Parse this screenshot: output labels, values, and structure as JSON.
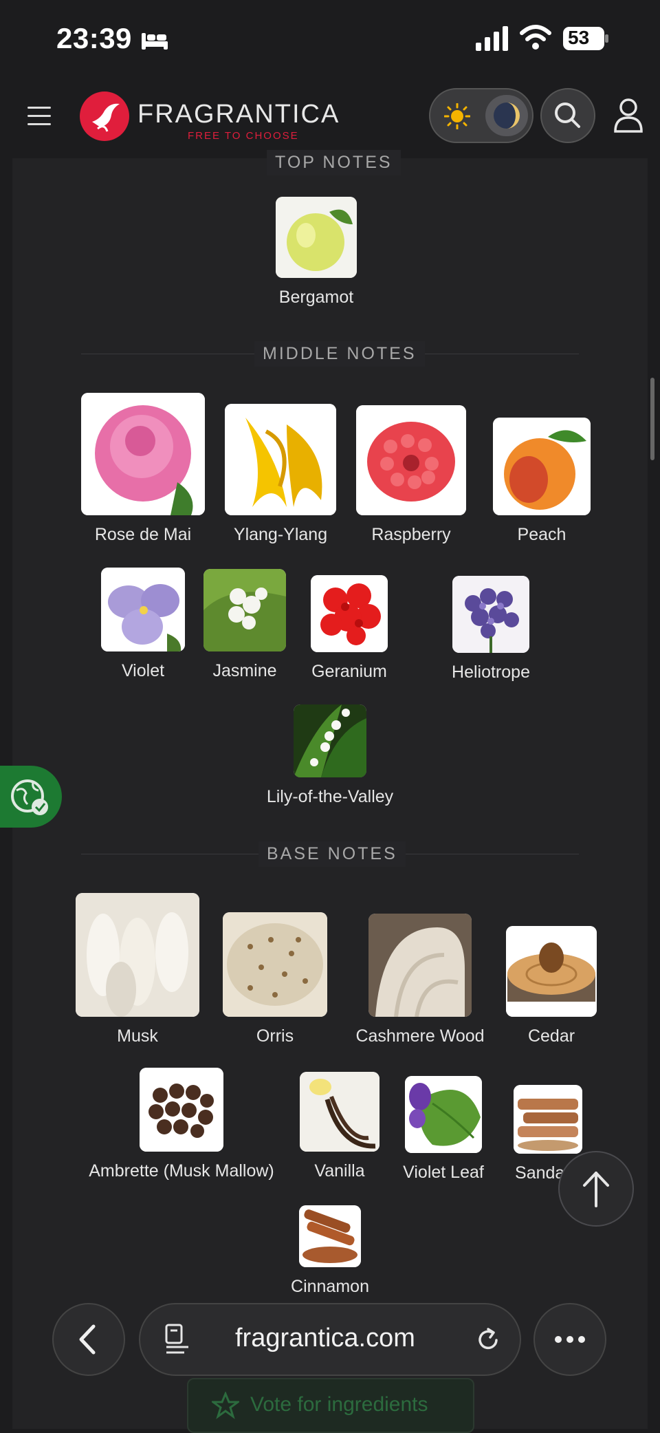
{
  "status_bar": {
    "time": "23:39",
    "battery": "53"
  },
  "header": {
    "logo_text": "FRAGRANTICA",
    "logo_tagline": "FREE TO CHOOSE"
  },
  "pyramid": {
    "top_label": "TOP NOTES",
    "top": [
      "Bergamot"
    ],
    "middle_label": "MIDDLE NOTES",
    "middle": [
      "Rose de Mai",
      "Ylang-Ylang",
      "Raspberry",
      "Peach",
      "Violet",
      "Jasmine",
      "Geranium",
      "Heliotrope",
      "Lily-of-the-Valley"
    ],
    "base_label": "BASE NOTES",
    "base": [
      "Musk",
      "Orris",
      "Cashmere Wood",
      "Cedar",
      "Ambrette (Musk Mallow)",
      "Vanilla",
      "Violet Leaf",
      "Sandalw",
      "Cinnamon"
    ]
  },
  "vote_button": "Vote for ingredients",
  "browser": {
    "url": "fragrantica.com"
  },
  "colors": {
    "brand": "#e01e3c",
    "background": "#1c1c1e",
    "panel": "#232325",
    "badge_green": "#1d7a32"
  },
  "icons": [
    "bed-icon",
    "signal-icon",
    "wifi-icon",
    "hamburger-icon",
    "sun-icon",
    "moon-icon",
    "search-icon",
    "user-icon",
    "globe-check-icon",
    "arrow-up-icon",
    "back-arrow-icon",
    "reader-icon",
    "reload-icon",
    "more-icon",
    "star-icon"
  ]
}
